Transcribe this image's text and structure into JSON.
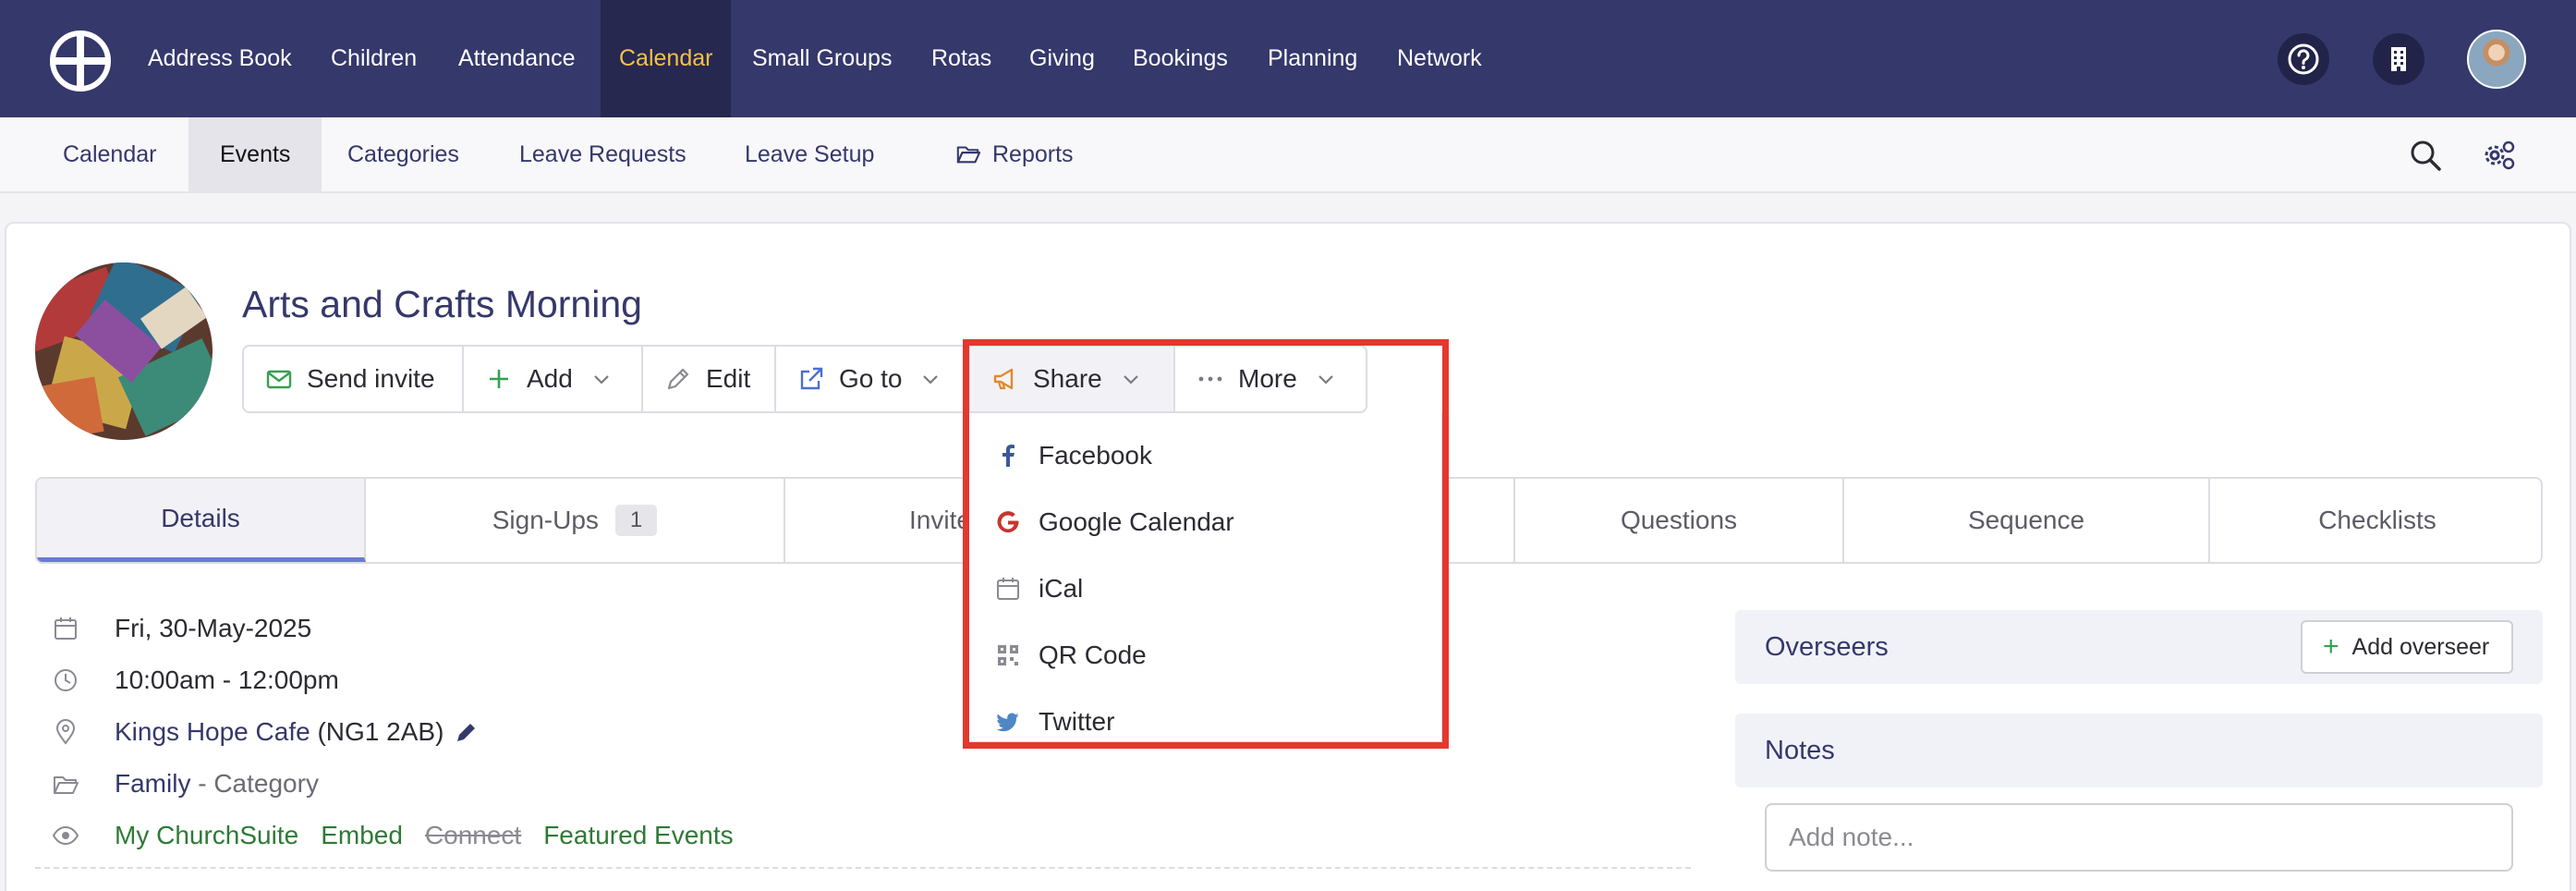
{
  "topnav": {
    "items": [
      "Address Book",
      "Children",
      "Attendance",
      "Calendar",
      "Small Groups",
      "Rotas",
      "Giving",
      "Bookings",
      "Planning",
      "Network"
    ],
    "active_index": 3
  },
  "subnav": {
    "items": [
      "Calendar",
      "Events",
      "Categories",
      "Leave Requests",
      "Leave Setup",
      "Reports"
    ],
    "active_index": 1
  },
  "event": {
    "title": "Arts and Crafts Morning"
  },
  "toolbar": {
    "send_invite": "Send invite",
    "add": "Add",
    "edit": "Edit",
    "go_to": "Go to",
    "share": "Share",
    "more": "More"
  },
  "share_menu": {
    "items": [
      "Facebook",
      "Google Calendar",
      "iCal",
      "QR Code",
      "Twitter"
    ]
  },
  "tabs": {
    "items": [
      "Details",
      "Sign-Ups",
      "Invite",
      "Questions",
      "Sequence",
      "Checklists"
    ],
    "signups_count": "1",
    "active_index": 0
  },
  "details": {
    "date": "Fri, 30-May-2025",
    "time": "10:00am - 12:00pm",
    "location_name": "Kings Hope Cafe",
    "location_postcode": "(NG1 2AB)",
    "category_name": "Family",
    "category_suffix": "- Category",
    "visibility": {
      "my_churchsuite": "My ChurchSuite",
      "embed": "Embed",
      "connect": "Connect",
      "featured": "Featured Events"
    }
  },
  "overseers": {
    "title": "Overseers",
    "add_label": "Add overseer"
  },
  "notes": {
    "title": "Notes",
    "placeholder": "Add note..."
  },
  "colors": {
    "nav_bg": "#35386b",
    "nav_active_bg": "#26284f",
    "nav_active_text": "#f5c04a",
    "link": "#35386b",
    "green": "#2f7a35",
    "highlight": "#e4382e"
  }
}
